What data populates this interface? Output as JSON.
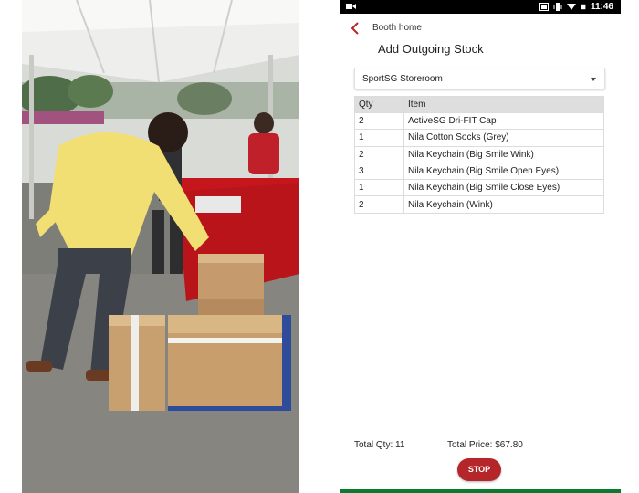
{
  "status_bar": {
    "time": "11:46",
    "icons": [
      "video-camera-icon",
      "cast-icon",
      "vibrate-icon",
      "wifi-icon",
      "battery-icon"
    ]
  },
  "app": {
    "back_label": "Booth home",
    "title": "Add Outgoing Stock",
    "back_icon": "chevron-left-icon",
    "accent_color": "#b5262b"
  },
  "location_select": {
    "value": "SportSG Storeroom"
  },
  "stock_table": {
    "columns": [
      "Qty",
      "Item"
    ],
    "rows": [
      {
        "qty": "2",
        "item": "ActiveSG Dri-FIT Cap"
      },
      {
        "qty": "1",
        "item": "Nila Cotton Socks (Grey)"
      },
      {
        "qty": "2",
        "item": "Nila Keychain (Big Smile Wink)"
      },
      {
        "qty": "3",
        "item": "Nila Keychain (Big Smile Open Eyes)"
      },
      {
        "qty": "1",
        "item": "Nila Keychain (Big Smile Close Eyes)"
      },
      {
        "qty": "2",
        "item": "Nila Keychain (Wink)"
      }
    ]
  },
  "totals": {
    "qty_text": "Total Qty: 11",
    "price_text": "Total Price: $67.80"
  },
  "actions": {
    "stop_label": "STOP"
  },
  "photo": {
    "subject": "photo-of-person-scanning-boxes-at-booth"
  }
}
